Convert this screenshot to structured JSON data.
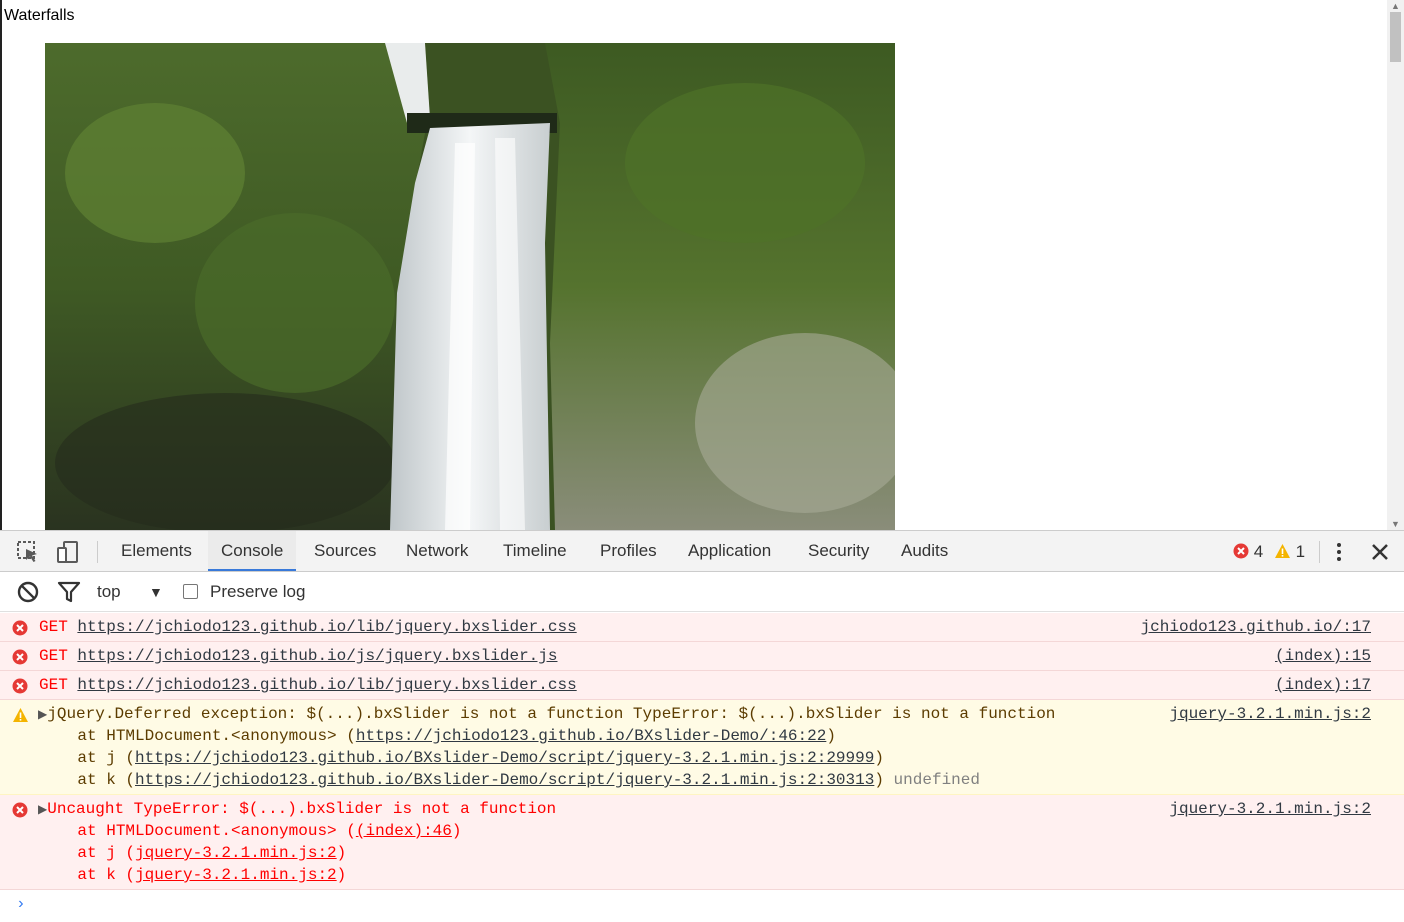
{
  "page": {
    "title": "Waterfalls"
  },
  "devtools": {
    "tabs": [
      "Elements",
      "Console",
      "Sources",
      "Network",
      "Timeline",
      "Profiles",
      "Application",
      "Security",
      "Audits"
    ],
    "active_tab": "Console",
    "error_count": "4",
    "warning_count": "1",
    "filter": {
      "context": "top",
      "preserve_log": "Preserve log",
      "preserve_checked": false
    },
    "messages": [
      {
        "type": "error",
        "text": "GET",
        "url": "https://jchiodo123.github.io/lib/jquery.bxslider.css",
        "source": "jchiodo123.github.io/:17"
      },
      {
        "type": "error",
        "text": "GET",
        "url": "https://jchiodo123.github.io/js/jquery.bxslider.js",
        "source": "(index):15"
      },
      {
        "type": "error",
        "text": "GET",
        "url": "https://jchiodo123.github.io/lib/jquery.bxslider.css",
        "source": "(index):17"
      },
      {
        "type": "warning",
        "text": "jQuery.Deferred exception: $(...).bxSlider is not a function TypeError: $(...).bxSlider is not a function",
        "source": "jquery-3.2.1.min.js:2",
        "stack": [
          {
            "prefix": "    at HTMLDocument.<anonymous> (",
            "link": "https://jchiodo123.github.io/BXslider-Demo/:46:22",
            "suffix": ")"
          },
          {
            "prefix": "    at j (",
            "link": "https://jchiodo123.github.io/BXslider-Demo/script/jquery-3.2.1.min.js:2:29999",
            "suffix": ")"
          },
          {
            "prefix": "    at k (",
            "link": "https://jchiodo123.github.io/BXslider-Demo/script/jquery-3.2.1.min.js:2:30313",
            "suffix": ")",
            "trailing": " undefined"
          }
        ]
      },
      {
        "type": "error",
        "text": "Uncaught TypeError: $(...).bxSlider is not a function",
        "source": "jquery-3.2.1.min.js:2",
        "stack": [
          {
            "prefix": "    at HTMLDocument.<anonymous> (",
            "link": "(index):46",
            "suffix": ")"
          },
          {
            "prefix": "    at j (",
            "link": "jquery-3.2.1.min.js:2",
            "suffix": ")"
          },
          {
            "prefix": "    at k (",
            "link": "jquery-3.2.1.min.js:2",
            "suffix": ")"
          }
        ]
      }
    ],
    "prompt_symbol": "›"
  },
  "icons": {
    "inspect": "inspect-element-icon",
    "device": "device-toolbar-icon",
    "clear": "clear-console-icon",
    "filter": "filter-icon",
    "error": "error-icon",
    "warning": "warning-icon",
    "menu": "kebab-menu-icon",
    "close": "close-icon"
  },
  "colors": {
    "error_bg": "#fff0f0",
    "warning_bg": "#fffbe5",
    "error_text": "#ff0000",
    "accent": "#3879d9"
  }
}
